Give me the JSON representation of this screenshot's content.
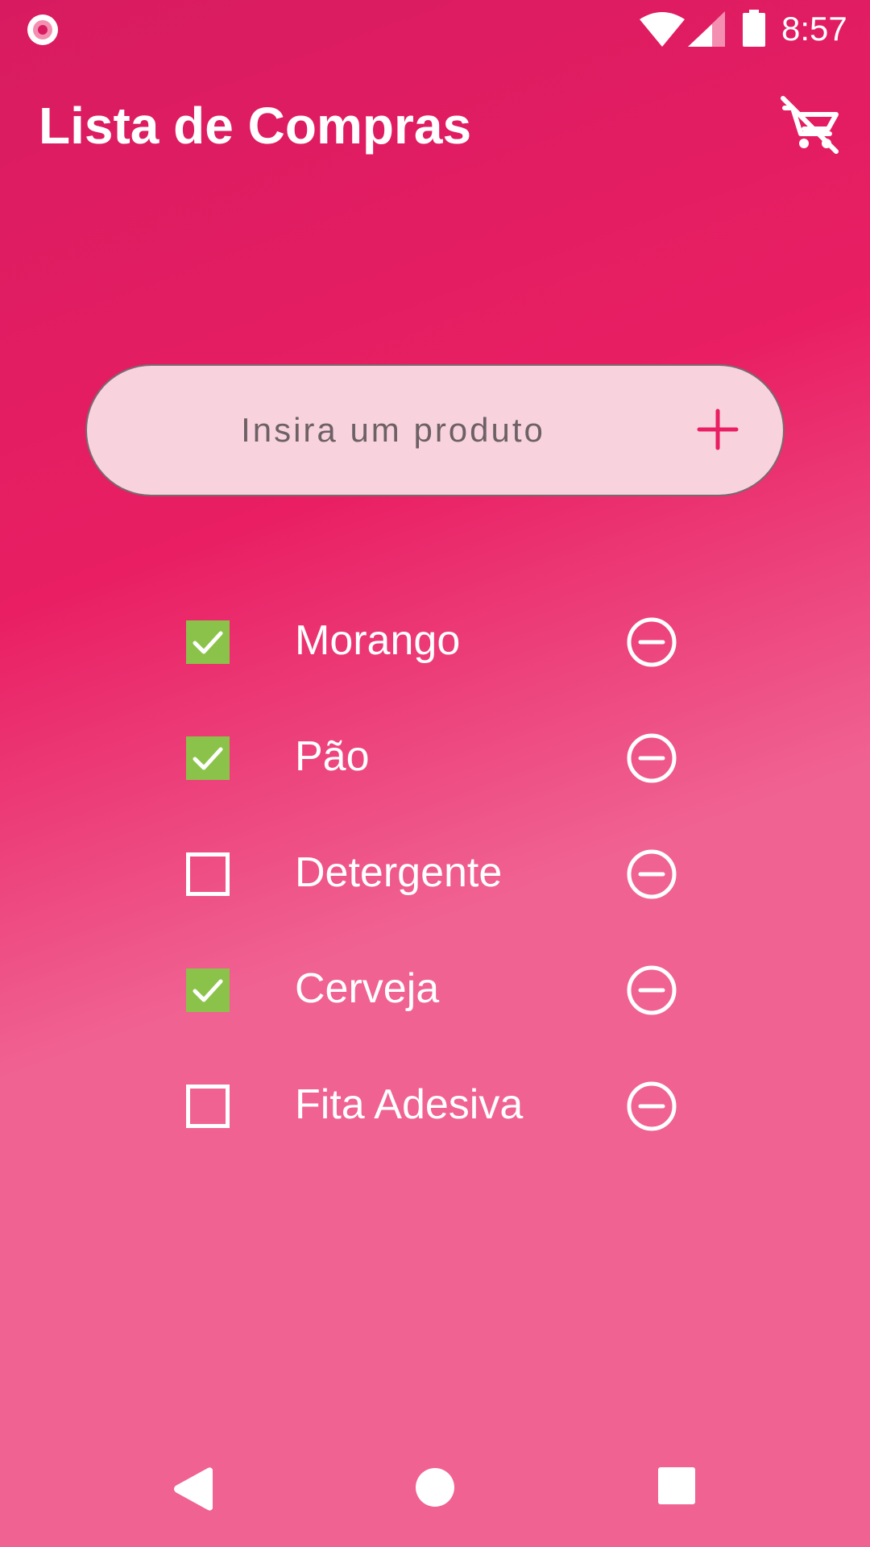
{
  "status_bar": {
    "time": "8:57",
    "icons": [
      "notification-record-icon",
      "wifi-icon",
      "signal-icon",
      "battery-icon"
    ]
  },
  "app_bar": {
    "title": "Lista de Compras",
    "action_icon": "remove-shopping-cart-icon"
  },
  "product_input": {
    "placeholder": "Insira um produto",
    "value": "",
    "add_icon": "plus-icon"
  },
  "items": [
    {
      "label": "Morango",
      "checked": true
    },
    {
      "label": "Pão",
      "checked": true
    },
    {
      "label": "Detergente",
      "checked": false
    },
    {
      "label": "Cerveja",
      "checked": true
    },
    {
      "label": "Fita Adesiva",
      "checked": false
    }
  ],
  "item_remove_icon": "remove-circle-icon",
  "nav_bar": {
    "icons": [
      "back-icon",
      "home-icon",
      "recents-icon"
    ]
  },
  "colors": {
    "gradient_start": "#d81b60",
    "gradient_mid": "#e91e63",
    "gradient_end": "#f06292",
    "input_background": "#f8d3dd",
    "accent": "#e91e63",
    "checked_fill": "#8bc34a",
    "foreground": "#ffffff"
  }
}
